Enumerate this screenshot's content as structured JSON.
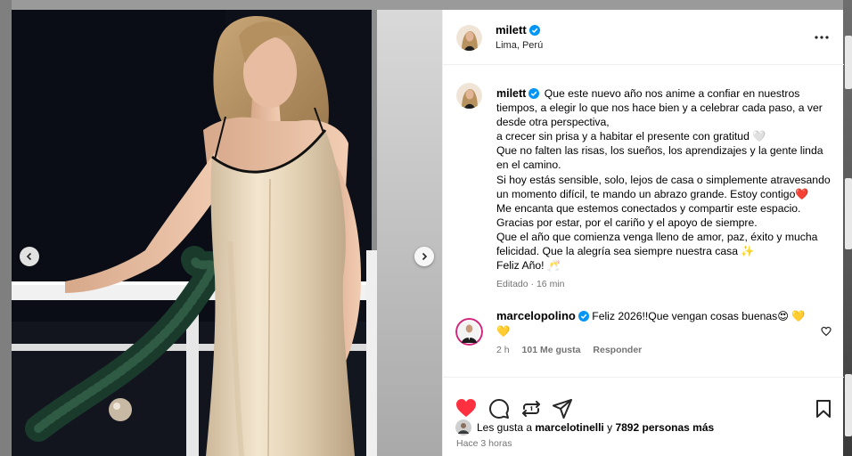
{
  "post": {
    "author": "milett",
    "location": "Lima, Perú",
    "caption_lines": [
      "Que este nuevo año nos anime a confiar en nuestros tiempos, a elegir lo que nos hace bien y a celebrar cada paso, a ver desde otra perspectiva,",
      "a crecer sin prisa y a habitar el presente con gratitud 🤍",
      "Que no falten las risas, los sueños, los aprendizajes y la gente linda en el camino.",
      "Si hoy estás sensible, solo, lejos de casa o simplemente atravesando un momento difícil, te mando un abrazo grande. Estoy contigo❤️",
      "Me encanta que estemos conectados y compartir este espacio.",
      "Gracias por estar, por el cariño y el apoyo de siempre.",
      "Que el año que comienza venga lleno de amor, paz, éxito y mucha felicidad. Que la alegría sea siempre nuestra casa ✨",
      "Feliz Año! 🥂"
    ],
    "edited_label": "Editado",
    "edited_time": "16 min",
    "likes_prefix": "Les gusta a",
    "likes_user": "marcelotinelli",
    "likes_and": "y",
    "likes_count": "7892 personas más",
    "time_ago": "Hace 3 horas",
    "liked": true
  },
  "comment": {
    "author": "marcelopolino",
    "text": "Feliz 2026!!Que vengan cosas buenas😍 💛💛",
    "time": "2 h",
    "likes": "101 Me gusta",
    "reply_label": "Responder"
  },
  "colors": {
    "like_red": "#ff3040",
    "verified_blue": "#0095f6",
    "secondary_text": "#737373"
  },
  "icons": {
    "more": "more-icon",
    "heart": "heart-icon",
    "comment": "comment-icon",
    "share": "share-icon",
    "send": "send-icon",
    "save": "bookmark-icon",
    "prev": "chevron-left-icon",
    "next": "chevron-right-icon"
  }
}
